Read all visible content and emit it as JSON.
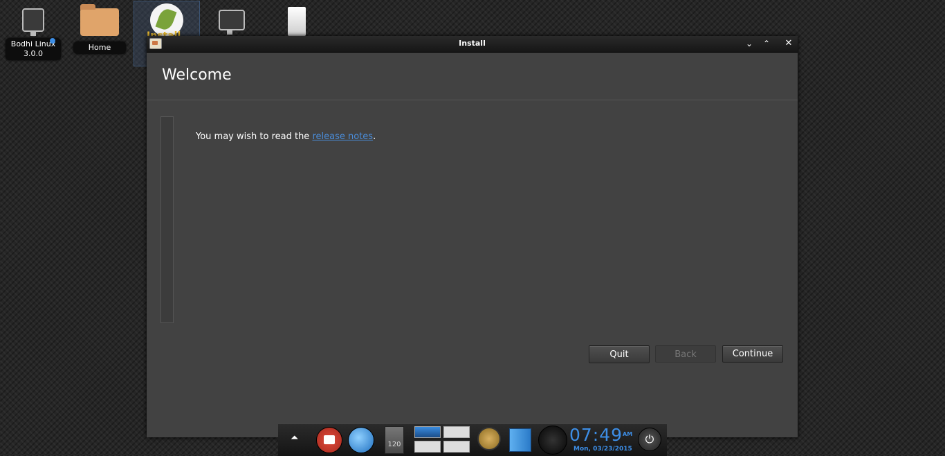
{
  "desktop": {
    "icons": [
      {
        "label": "Bodhi Linux\n3.0.0"
      },
      {
        "label": "Home"
      },
      {
        "label": "Install"
      },
      {
        "label": ""
      },
      {
        "label": ""
      }
    ]
  },
  "window": {
    "title": "Install",
    "controls": {
      "minimize": "⌄",
      "maximize": "⌃",
      "close": "✕"
    }
  },
  "page": {
    "heading": "Welcome",
    "message_prefix": "You may wish to read the ",
    "message_link": "release notes",
    "message_suffix": "."
  },
  "buttons": {
    "quit": "Quit",
    "back": "Back",
    "continue": "Continue"
  },
  "dock": {
    "counter_badge": "120",
    "clock_time": "07:49",
    "clock_ampm": "AM",
    "clock_date": "Mon, 03/23/2015"
  },
  "colors": {
    "accent": "#3d8ee6",
    "link": "#4a8cd8",
    "window_bg": "#424242"
  }
}
